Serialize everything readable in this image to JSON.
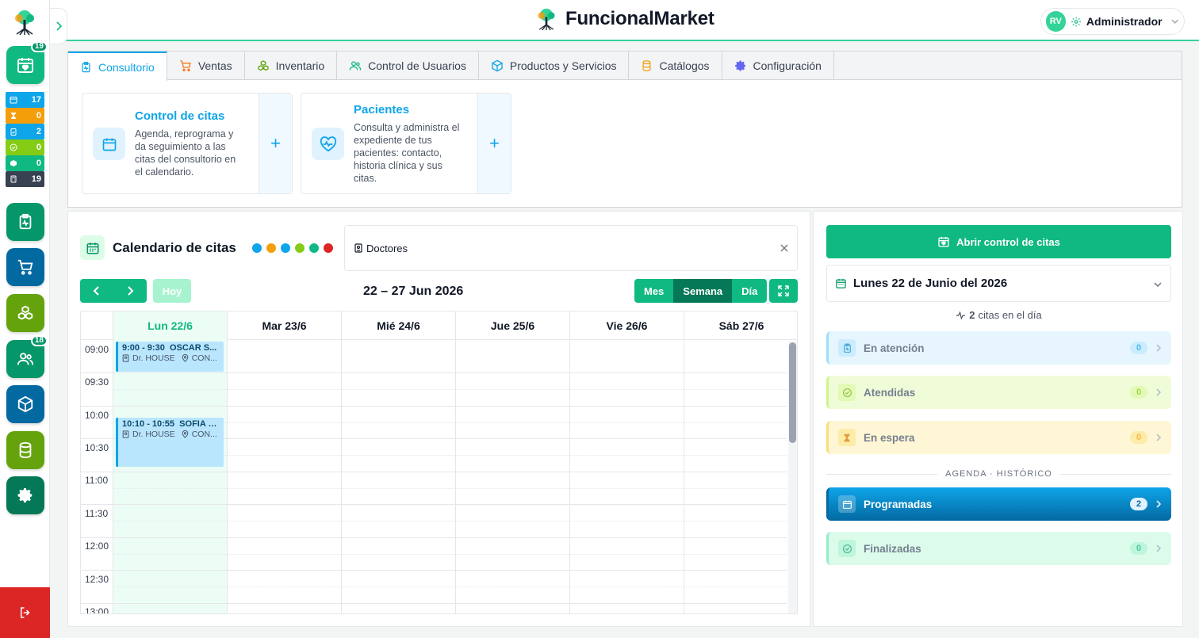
{
  "sidebar": {
    "top_badge": "19",
    "stats": [
      {
        "icon": "calendar-icon",
        "value": "17",
        "color": "#0ea5e9"
      },
      {
        "icon": "hourglass-icon",
        "value": "0",
        "color": "#f59e0b"
      },
      {
        "icon": "clipboard-icon",
        "value": "2",
        "color": "#0ea5e9"
      },
      {
        "icon": "check-circle-icon",
        "value": "0",
        "color": "#84cc16"
      },
      {
        "icon": "box-icon",
        "value": "0",
        "color": "#10b981"
      },
      {
        "icon": "calculator-icon",
        "value": "19",
        "color": "#374151"
      }
    ],
    "users_badge": "18"
  },
  "header": {
    "brand": "FuncionalMarket",
    "user_initials": "RV",
    "user_name": "Administrador"
  },
  "tabs": [
    {
      "label": "Consultorio",
      "icon": "clipboard-pulse-icon"
    },
    {
      "label": "Ventas",
      "icon": "cart-icon"
    },
    {
      "label": "Inventario",
      "icon": "boxes-icon"
    },
    {
      "label": "Control de Usuarios",
      "icon": "users-icon"
    },
    {
      "label": "Productos y Servicios",
      "icon": "package-icon"
    },
    {
      "label": "Catálogos",
      "icon": "database-icon"
    },
    {
      "label": "Configuración",
      "icon": "gear-icon"
    }
  ],
  "cards": [
    {
      "title": "Control de citas",
      "desc": [
        "Agenda, reprograma y",
        "da seguimiento a las",
        "citas del consultorio en",
        "el calendario."
      ]
    },
    {
      "title": "Pacientes",
      "desc": [
        "Consulta y administra el",
        "expediente de tus",
        "pacientes: contacto,",
        "historia clínica y sus",
        "citas."
      ]
    }
  ],
  "calendar": {
    "title": "Calendario de citas",
    "dot_colors": [
      "#0ea5e9",
      "#f59e0b",
      "#0ea5e9",
      "#84cc16",
      "#10b981",
      "#dc2626"
    ],
    "doctor_filter": "Doctores",
    "today_label": "Hoy",
    "range": "22 – 27 Jun 2026",
    "views": [
      "Mes",
      "Semana",
      "Día"
    ],
    "active_view": "Semana",
    "days": [
      "Lun 22/6",
      "Mar 23/6",
      "Mié 24/6",
      "Jue 25/6",
      "Vie 26/6",
      "Sáb 27/6"
    ],
    "times": [
      "09:00",
      "09:30",
      "10:00",
      "10:30",
      "11:00",
      "11:30",
      "12:00",
      "12:30",
      "13:00"
    ],
    "events": [
      {
        "time": "9:00 - 9:30",
        "patient": "OSCAR S...",
        "doctor": "Dr. HOUSE",
        "place": "CON..."
      },
      {
        "time": "10:10 - 10:55",
        "patient": "SOFIA T...",
        "doctor": "Dr. HOUSE",
        "place": "CON..."
      }
    ]
  },
  "right": {
    "open_button": "Abrir control de citas",
    "date": "Lunes 22 de Junio del 2026",
    "count": "2",
    "count_suffix": "citas en el día",
    "status": [
      {
        "label": "En atención",
        "count": "0"
      },
      {
        "label": "Atendidas",
        "count": "0"
      },
      {
        "label": "En espera",
        "count": "0"
      }
    ],
    "history_label": "AGENDA · HISTÓRICO",
    "history": [
      {
        "label": "Programadas",
        "count": "2"
      },
      {
        "label": "Finalizadas",
        "count": "0"
      }
    ]
  }
}
